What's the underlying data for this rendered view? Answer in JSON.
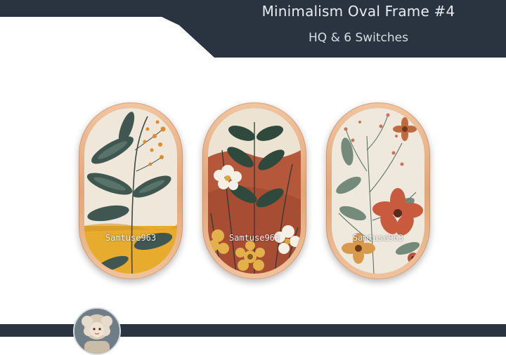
{
  "header": {
    "title": "Minimalism Oval Frame #4",
    "subtitle": "HQ & 6 Switches"
  },
  "frames": [
    {
      "watermark": "Samtuse963",
      "icon": "leaf-botanical-art"
    },
    {
      "watermark": "Samtuse963",
      "icon": "terracotta-flower-art"
    },
    {
      "watermark": "Samtuse963",
      "icon": "red-flower-botanical-art"
    }
  ],
  "colors": {
    "header_bg": "#2a3440",
    "frame_wood": "#e3a679",
    "accent_orange": "#e6a02c",
    "leaf_green": "#3e5a4c",
    "terracotta": "#b5573a"
  },
  "avatar": {
    "icon": "doll-avatar-icon"
  }
}
